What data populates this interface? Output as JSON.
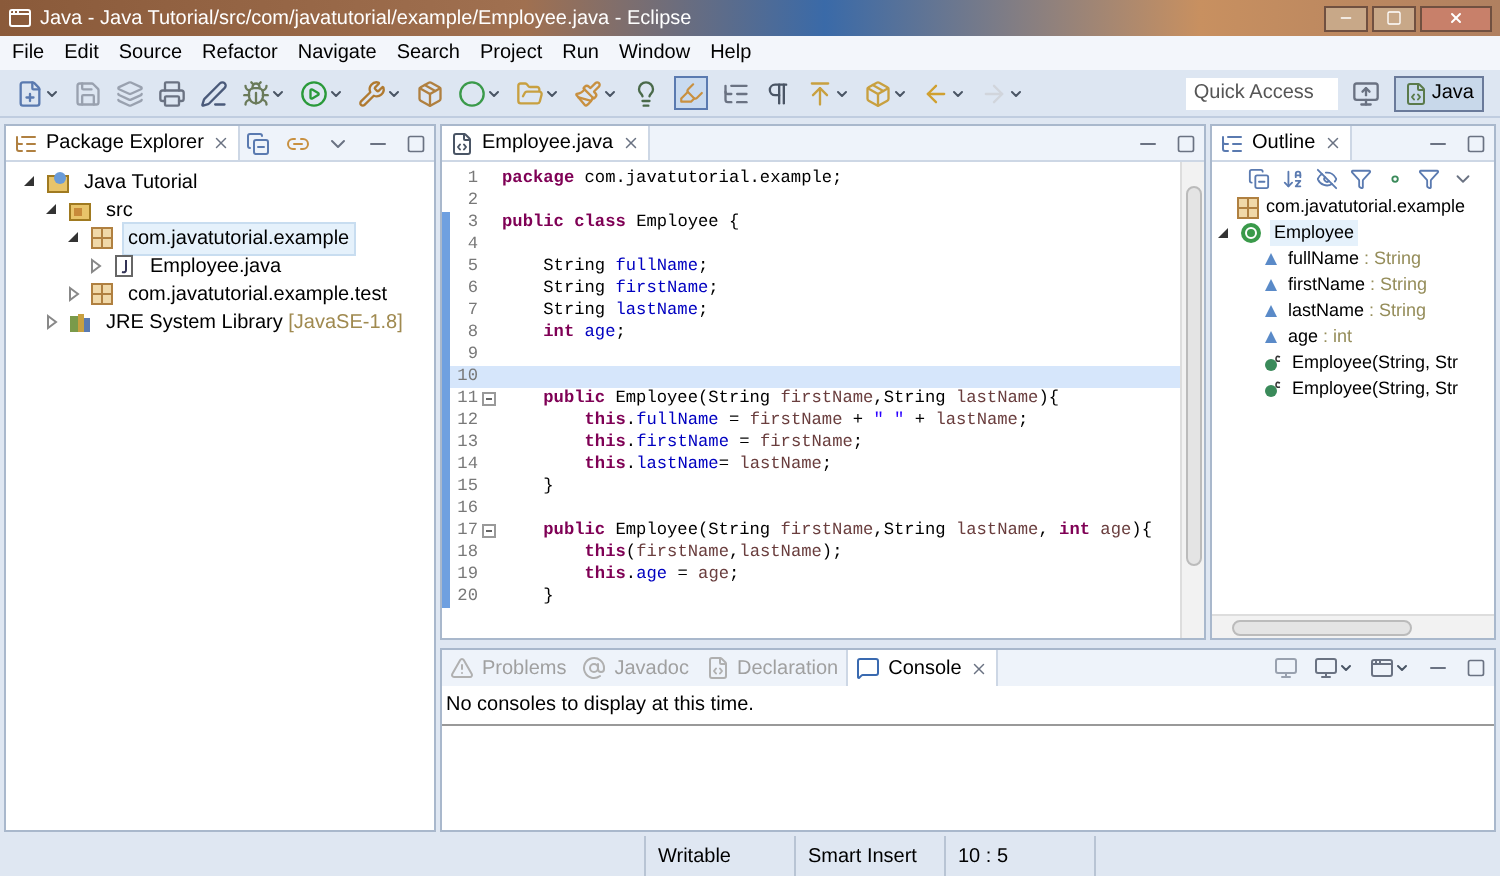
{
  "window": {
    "title": "Java - Java Tutorial/src/com/javatutorial/example/Employee.java - Eclipse"
  },
  "menu": [
    "File",
    "Edit",
    "Source",
    "Refactor",
    "Navigate",
    "Search",
    "Project",
    "Run",
    "Window",
    "Help"
  ],
  "toolbar": {
    "highlight_toggle_on": true,
    "quick_access": {
      "placeholder": "Quick Access"
    },
    "perspectives": [
      {
        "label": "Java",
        "selected": true
      }
    ]
  },
  "package_explorer": {
    "title": "Package Explorer",
    "tree": [
      {
        "kind": "project",
        "label": "Java Tutorial",
        "expanded": true,
        "selected": false,
        "children": [
          {
            "kind": "source_folder",
            "label": "src",
            "expanded": true,
            "selected": false,
            "children": [
              {
                "kind": "package",
                "label": "com.javatutorial.example",
                "expanded": true,
                "selected": true,
                "children": [
                  {
                    "kind": "java_file",
                    "label": "Employee.java",
                    "expanded": false,
                    "selected": false
                  }
                ]
              },
              {
                "kind": "package",
                "label": "com.javatutorial.example.test",
                "expanded": false,
                "selected": false
              }
            ]
          },
          {
            "kind": "library",
            "label": "JRE System Library",
            "suffix": "[JavaSE-1.8]",
            "expanded": false,
            "selected": false
          }
        ]
      }
    ]
  },
  "editor": {
    "tab": "Employee.java",
    "lines": [
      {
        "number": "1",
        "in_range": false,
        "current": false,
        "tokens": [
          {
            "kind": "keyword",
            "text": "package"
          },
          {
            "kind": "plain",
            "text": " com.javatutorial.example;"
          }
        ]
      },
      {
        "number": "2",
        "in_range": false,
        "current": false
      },
      {
        "number": "3",
        "in_range": true,
        "current": false,
        "tokens": [
          {
            "kind": "keyword",
            "text": "public"
          },
          {
            "kind": "keyword",
            "text": " class"
          },
          {
            "kind": "plain",
            "text": " Employee {"
          }
        ]
      },
      {
        "number": "4",
        "in_range": true,
        "current": false
      },
      {
        "number": "5",
        "in_range": true,
        "current": false,
        "tokens": [
          {
            "kind": "plain",
            "text": "    String "
          },
          {
            "kind": "field",
            "text": "fullName"
          },
          {
            "kind": "plain",
            "text": ";"
          }
        ]
      },
      {
        "number": "6",
        "in_range": true,
        "current": false,
        "tokens": [
          {
            "kind": "plain",
            "text": "    String "
          },
          {
            "kind": "field",
            "text": "firstName"
          },
          {
            "kind": "plain",
            "text": ";"
          }
        ]
      },
      {
        "number": "7",
        "in_range": true,
        "current": false,
        "tokens": [
          {
            "kind": "plain",
            "text": "    String "
          },
          {
            "kind": "field",
            "text": "lastName"
          },
          {
            "kind": "plain",
            "text": ";"
          }
        ]
      },
      {
        "number": "8",
        "in_range": true,
        "current": false,
        "tokens": [
          {
            "kind": "keyword",
            "text": "    int"
          },
          {
            "kind": "field",
            "text": " age"
          },
          {
            "kind": "plain",
            "text": ";"
          }
        ]
      },
      {
        "number": "9",
        "in_range": true,
        "current": false
      },
      {
        "number": "10",
        "in_range": true,
        "current": true
      },
      {
        "number": "11",
        "in_range": true,
        "current": false,
        "foldable": true,
        "tokens": [
          {
            "kind": "keyword",
            "text": "    public"
          },
          {
            "kind": "plain",
            "text": " Employee(String "
          },
          {
            "kind": "param",
            "text": "firstName"
          },
          {
            "kind": "plain",
            "text": ",String "
          },
          {
            "kind": "param",
            "text": "lastName"
          },
          {
            "kind": "plain",
            "text": "){"
          }
        ]
      },
      {
        "number": "12",
        "in_range": true,
        "current": false,
        "tokens": [
          {
            "kind": "keyword",
            "text": "        this"
          },
          {
            "kind": "plain",
            "text": "."
          },
          {
            "kind": "field",
            "text": "fullName"
          },
          {
            "kind": "plain",
            "text": " = "
          },
          {
            "kind": "param",
            "text": "firstName"
          },
          {
            "kind": "plain",
            "text": " + "
          },
          {
            "kind": "string",
            "text": "\" \""
          },
          {
            "kind": "plain",
            "text": " + "
          },
          {
            "kind": "param",
            "text": "lastName"
          },
          {
            "kind": "plain",
            "text": ";"
          }
        ]
      },
      {
        "number": "13",
        "in_range": true,
        "current": false,
        "tokens": [
          {
            "kind": "keyword",
            "text": "        this"
          },
          {
            "kind": "plain",
            "text": "."
          },
          {
            "kind": "field",
            "text": "firstName"
          },
          {
            "kind": "plain",
            "text": " = "
          },
          {
            "kind": "param",
            "text": "firstName"
          },
          {
            "kind": "plain",
            "text": ";"
          }
        ]
      },
      {
        "number": "14",
        "in_range": true,
        "current": false,
        "tokens": [
          {
            "kind": "keyword",
            "text": "        this"
          },
          {
            "kind": "plain",
            "text": "."
          },
          {
            "kind": "field",
            "text": "lastName"
          },
          {
            "kind": "plain",
            "text": "= "
          },
          {
            "kind": "param",
            "text": "lastName"
          },
          {
            "kind": "plain",
            "text": ";"
          }
        ]
      },
      {
        "number": "15",
        "in_range": true,
        "current": false,
        "tokens": [
          {
            "kind": "plain",
            "text": "    }"
          }
        ]
      },
      {
        "number": "16",
        "in_range": true,
        "current": false
      },
      {
        "number": "17",
        "in_range": true,
        "current": false,
        "foldable": true,
        "tokens": [
          {
            "kind": "keyword",
            "text": "    public"
          },
          {
            "kind": "plain",
            "text": " Employee(String "
          },
          {
            "kind": "param",
            "text": "firstName"
          },
          {
            "kind": "plain",
            "text": ",String "
          },
          {
            "kind": "param",
            "text": "lastName"
          },
          {
            "kind": "plain",
            "text": ", "
          },
          {
            "kind": "keyword",
            "text": "int"
          },
          {
            "kind": "param",
            "text": " age"
          },
          {
            "kind": "plain",
            "text": "){"
          }
        ]
      },
      {
        "number": "18",
        "in_range": true,
        "current": false,
        "tokens": [
          {
            "kind": "keyword",
            "text": "        this"
          },
          {
            "kind": "plain",
            "text": "("
          },
          {
            "kind": "param",
            "text": "firstName"
          },
          {
            "kind": "plain",
            "text": ","
          },
          {
            "kind": "param",
            "text": "lastName"
          },
          {
            "kind": "plain",
            "text": ");"
          }
        ]
      },
      {
        "number": "19",
        "in_range": true,
        "current": false,
        "tokens": [
          {
            "kind": "keyword",
            "text": "        this"
          },
          {
            "kind": "plain",
            "text": "."
          },
          {
            "kind": "field",
            "text": "age"
          },
          {
            "kind": "plain",
            "text": " = "
          },
          {
            "kind": "param",
            "text": "age"
          },
          {
            "kind": "plain",
            "text": ";"
          }
        ]
      },
      {
        "number": "20",
        "in_range": true,
        "current": false,
        "tokens": [
          {
            "kind": "plain",
            "text": "    }"
          }
        ]
      }
    ]
  },
  "outline": {
    "title": "Outline",
    "package": "com.javatutorial.example",
    "type": {
      "name": "Employee",
      "expanded": true,
      "members": [
        {
          "kind": "field",
          "name": "fullName",
          "type": ": String"
        },
        {
          "kind": "field",
          "name": "firstName",
          "type": ": String"
        },
        {
          "kind": "field",
          "name": "lastName",
          "type": ": String"
        },
        {
          "kind": "field",
          "name": "age",
          "type": ": int"
        },
        {
          "kind": "constructor",
          "name": "Employee(String, Str"
        },
        {
          "kind": "constructor",
          "name": "Employee(String, Str"
        }
      ]
    }
  },
  "bottom": {
    "tabs": [
      {
        "label": "Problems",
        "selected": false
      },
      {
        "label": "Javadoc",
        "selected": false
      },
      {
        "label": "Declaration",
        "selected": false
      },
      {
        "label": "Console",
        "selected": true
      }
    ],
    "message": "No consoles to display at this time."
  },
  "status_bar": [
    "Writable",
    "Smart Insert",
    "10 : 5"
  ]
}
